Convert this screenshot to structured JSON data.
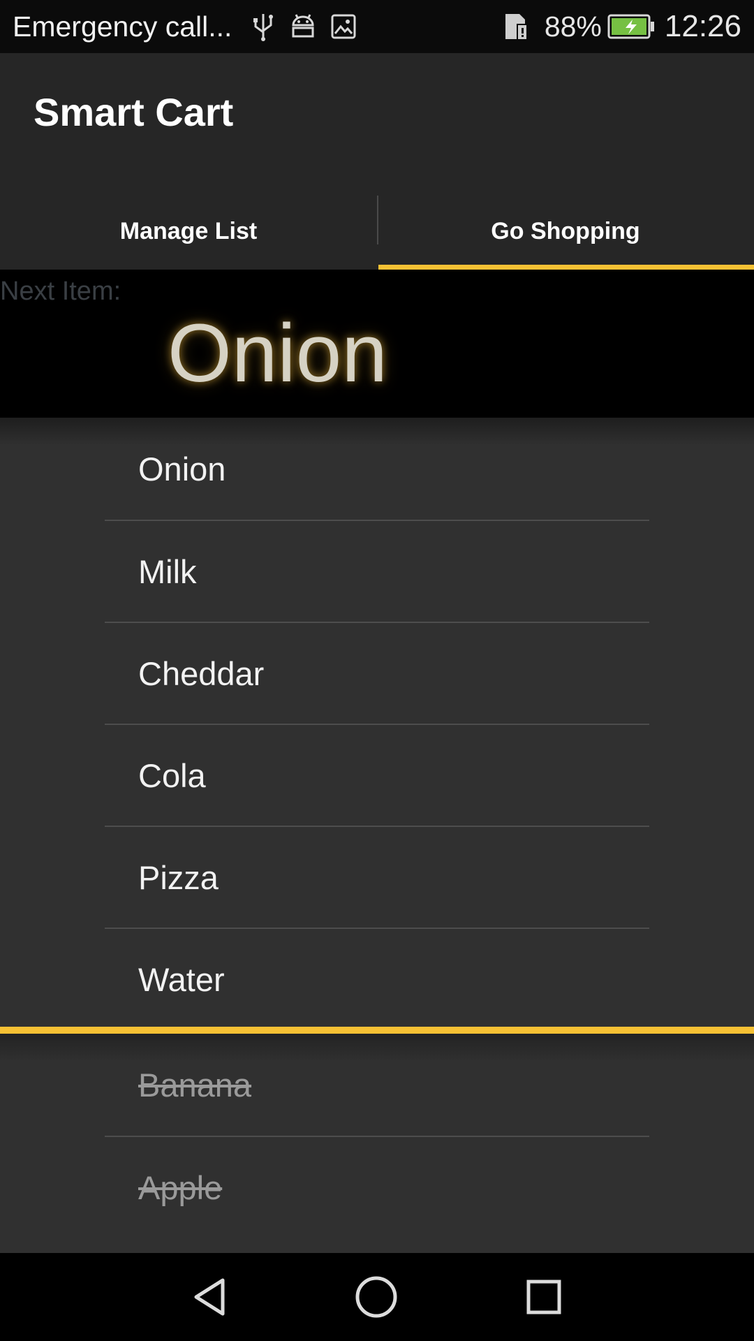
{
  "status_bar": {
    "carrier_text": "Emergency call...",
    "battery_percent": "88%",
    "time": "12:26",
    "icons": [
      "usb-icon",
      "android-debug-icon",
      "image-icon",
      "sim-icon",
      "battery-charging-icon"
    ],
    "battery_color": "#76c043"
  },
  "app": {
    "title": "Smart Cart"
  },
  "tabs": [
    {
      "label": "Manage List",
      "active": false
    },
    {
      "label": "Go Shopping",
      "active": true
    }
  ],
  "accent_color": "#f7c134",
  "next_item": {
    "label": "Next Item:",
    "name": "Onion"
  },
  "shopping_list": [
    {
      "name": "Onion"
    },
    {
      "name": "Milk"
    },
    {
      "name": "Cheddar"
    },
    {
      "name": "Cola"
    },
    {
      "name": "Pizza"
    },
    {
      "name": "Water"
    }
  ],
  "completed_list": [
    {
      "name": "Banana"
    },
    {
      "name": "Apple"
    }
  ],
  "nav_bar": {
    "icons": [
      "back-icon",
      "home-icon",
      "recents-icon"
    ]
  }
}
